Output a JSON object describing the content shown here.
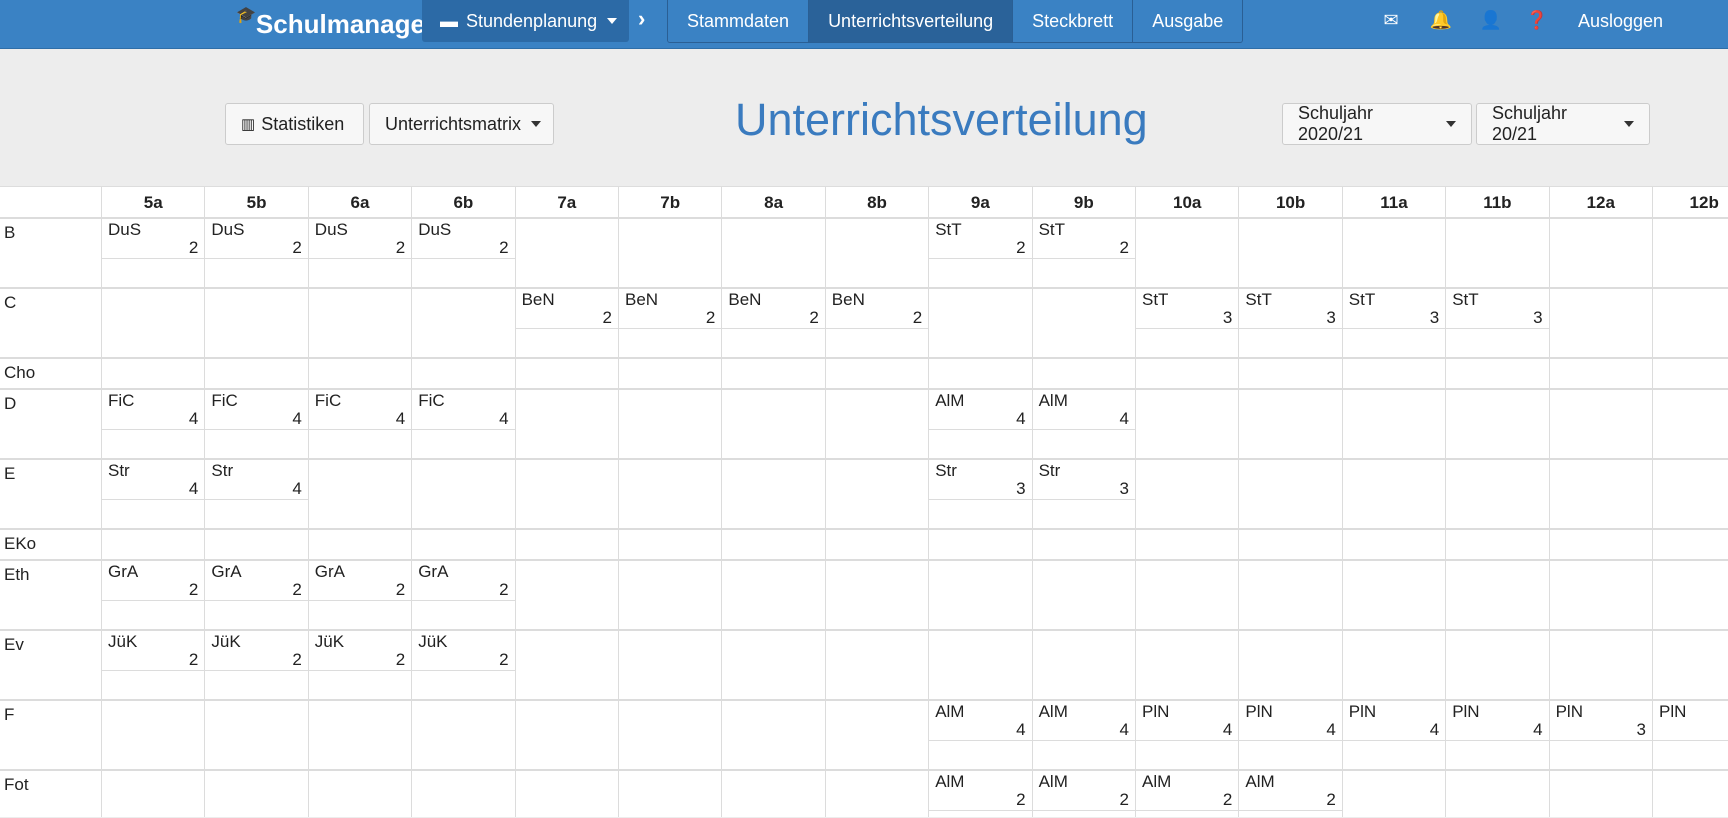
{
  "nav": {
    "logo": "Schulmanager",
    "module": "Stundenplanung",
    "tabs": [
      "Stammdaten",
      "Unterrichtsverteilung",
      "Steckbrett",
      "Ausgabe"
    ],
    "active_tab": "Unterrichtsverteilung",
    "logout": "Ausloggen",
    "icons": [
      "mail-icon",
      "bell-icon",
      "user-icon",
      "help-icon"
    ]
  },
  "toolbar": {
    "stats": "Statistiken",
    "matrix": "Unterrichtsmatrix",
    "title": "Unterrichtsverteilung",
    "year1": "Schuljahr 2020/21",
    "year2": "Schuljahr 20/21"
  },
  "classes": [
    "5a",
    "5b",
    "6a",
    "6b",
    "7a",
    "7b",
    "8a",
    "8b",
    "9a",
    "9b",
    "10a",
    "10b",
    "11a",
    "11b",
    "12a",
    "12b"
  ],
  "rows": [
    {
      "subject": "B",
      "entries": [
        [
          "DuS",
          "2"
        ],
        [
          "DuS",
          "2"
        ],
        [
          "DuS",
          "2"
        ],
        [
          "DuS",
          "2"
        ],
        null,
        null,
        null,
        null,
        [
          "StT",
          "2"
        ],
        [
          "StT",
          "2"
        ],
        null,
        null,
        null,
        null,
        null,
        null
      ]
    },
    {
      "subject": "C",
      "entries": [
        null,
        null,
        null,
        null,
        [
          "BeN",
          "2"
        ],
        [
          "BeN",
          "2"
        ],
        [
          "BeN",
          "2"
        ],
        [
          "BeN",
          "2"
        ],
        null,
        null,
        [
          "StT",
          "3"
        ],
        [
          "StT",
          "3"
        ],
        [
          "StT",
          "3"
        ],
        [
          "StT",
          "3"
        ],
        null,
        null
      ]
    },
    {
      "subject": "Cho",
      "entries": [
        null,
        null,
        null,
        null,
        null,
        null,
        null,
        null,
        null,
        null,
        null,
        null,
        null,
        null,
        null,
        null
      ]
    },
    {
      "subject": "D",
      "entries": [
        [
          "FiC",
          "4"
        ],
        [
          "FiC",
          "4"
        ],
        [
          "FiC",
          "4"
        ],
        [
          "FiC",
          "4"
        ],
        null,
        null,
        null,
        null,
        [
          "AlM",
          "4"
        ],
        [
          "AlM",
          "4"
        ],
        null,
        null,
        null,
        null,
        null,
        null
      ]
    },
    {
      "subject": "E",
      "entries": [
        [
          "Str",
          "4"
        ],
        [
          "Str",
          "4"
        ],
        null,
        null,
        null,
        null,
        null,
        null,
        [
          "Str",
          "3"
        ],
        [
          "Str",
          "3"
        ],
        null,
        null,
        null,
        null,
        null,
        null
      ]
    },
    {
      "subject": "EKo",
      "entries": [
        null,
        null,
        null,
        null,
        null,
        null,
        null,
        null,
        null,
        null,
        null,
        null,
        null,
        null,
        null,
        null
      ]
    },
    {
      "subject": "Eth",
      "entries": [
        [
          "GrA",
          "2"
        ],
        [
          "GrA",
          "2"
        ],
        [
          "GrA",
          "2"
        ],
        [
          "GrA",
          "2"
        ],
        null,
        null,
        null,
        null,
        null,
        null,
        null,
        null,
        null,
        null,
        null,
        null
      ]
    },
    {
      "subject": "Ev",
      "entries": [
        [
          "JüK",
          "2"
        ],
        [
          "JüK",
          "2"
        ],
        [
          "JüK",
          "2"
        ],
        [
          "JüK",
          "2"
        ],
        null,
        null,
        null,
        null,
        null,
        null,
        null,
        null,
        null,
        null,
        null,
        null
      ]
    },
    {
      "subject": "F",
      "entries": [
        null,
        null,
        null,
        null,
        null,
        null,
        null,
        null,
        [
          "AlM",
          "4"
        ],
        [
          "AlM",
          "4"
        ],
        [
          "PlN",
          "4"
        ],
        [
          "PlN",
          "4"
        ],
        [
          "PlN",
          "4"
        ],
        [
          "PlN",
          "4"
        ],
        [
          "PlN",
          "3"
        ],
        [
          "PlN",
          ""
        ]
      ]
    },
    {
      "subject": "Fot",
      "entries": [
        null,
        null,
        null,
        null,
        null,
        null,
        null,
        null,
        [
          "AlM",
          "2"
        ],
        [
          "AlM",
          "2"
        ],
        [
          "AlM",
          "2"
        ],
        [
          "AlM",
          "2"
        ],
        null,
        null,
        null,
        null
      ]
    }
  ]
}
